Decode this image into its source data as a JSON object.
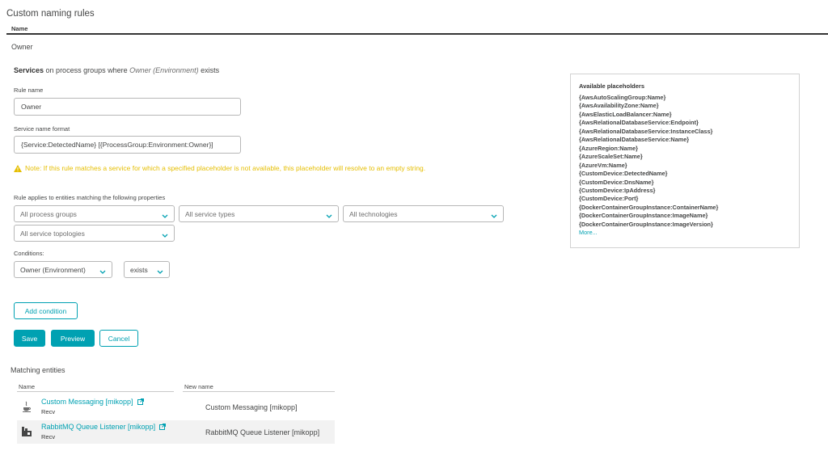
{
  "page": {
    "title": "Custom naming rules",
    "name_column": "Name",
    "rule_row_label": "Owner"
  },
  "rule_heading": {
    "entity": "Services",
    "middle": " on process groups where ",
    "condition": "Owner (Environment)",
    "suffix": " exists"
  },
  "rule_name": {
    "label": "Rule name",
    "value": "Owner"
  },
  "format": {
    "label": "Service name format",
    "value": "{Service:DetectedName} [{ProcessGroup:Environment:Owner}]"
  },
  "warning_text": "Note: If this rule matches a service for which a specified placeholder is not available, this placeholder will resolve to an empty string.",
  "applies": {
    "label": "Rule applies to entities matching the following properties",
    "process_groups": "All process groups",
    "service_types": "All service types",
    "technologies": "All technologies",
    "service_topologies": "All service topologies"
  },
  "conditions": {
    "label": "Conditions:",
    "property": "Owner (Environment)",
    "operator": "exists"
  },
  "buttons": {
    "add_condition": "Add condition",
    "save": "Save",
    "preview": "Preview",
    "cancel": "Cancel"
  },
  "placeholders": {
    "title": "Available placeholders",
    "items": [
      "{AwsAutoScalingGroup:Name}",
      "{AwsAvailabilityZone:Name}",
      "{AwsElasticLoadBalancer:Name}",
      "{AwsRelationalDatabaseService:Endpoint}",
      "{AwsRelationalDatabaseService:InstanceClass}",
      "{AwsRelationalDatabaseService:Name}",
      "{AzureRegion:Name}",
      "{AzureScaleSet:Name}",
      "{AzureVm:Name}",
      "{CustomDevice:DetectedName}",
      "{CustomDevice:DnsName}",
      "{CustomDevice:IpAddress}",
      "{CustomDevice:Port}",
      "{DockerContainerGroupInstance:ContainerName}",
      "{DockerContainerGroupInstance:ImageName}",
      "{DockerContainerGroupInstance:ImageVersion}"
    ],
    "more": "More..."
  },
  "matching": {
    "title": "Matching entities",
    "col_name": "Name",
    "col_new_name": "New name",
    "rows": [
      {
        "icon": "java-icon",
        "name": "Custom Messaging [mikopp]",
        "sub": "Recv",
        "new_name": "Custom Messaging [mikopp]"
      },
      {
        "icon": "rabbitmq-icon",
        "name": "RabbitMQ Queue Listener [mikopp]",
        "sub": "Recv",
        "new_name": "RabbitMQ Queue Listener [mikopp]"
      }
    ]
  },
  "colors": {
    "accent": "#00a1b2",
    "warning": "#e5be01",
    "text": "#454646"
  }
}
